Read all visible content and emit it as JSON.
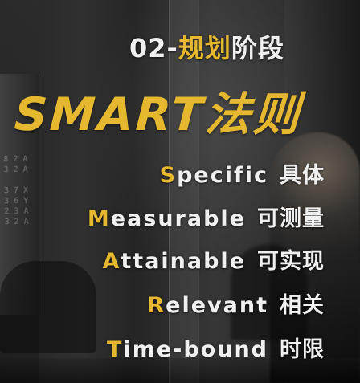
{
  "colors": {
    "accent": "#e5b82f",
    "text": "#f0f0f0",
    "background": "#2b2b2b"
  },
  "header": {
    "phase_prefix": "02-",
    "phase_highlight": "规划",
    "phase_rest": "阶段",
    "title": "SMART法则"
  },
  "principles": [
    {
      "initial": "S",
      "rest": "pecific",
      "chinese": "具体"
    },
    {
      "initial": "M",
      "rest": "easurable",
      "chinese": "可测量"
    },
    {
      "initial": "A",
      "rest": "ttainable",
      "chinese": "可实现"
    },
    {
      "initial": "R",
      "rest": "elevant",
      "chinese": "相关"
    },
    {
      "initial": "T",
      "rest": "ime-bound",
      "chinese": "时限"
    }
  ]
}
